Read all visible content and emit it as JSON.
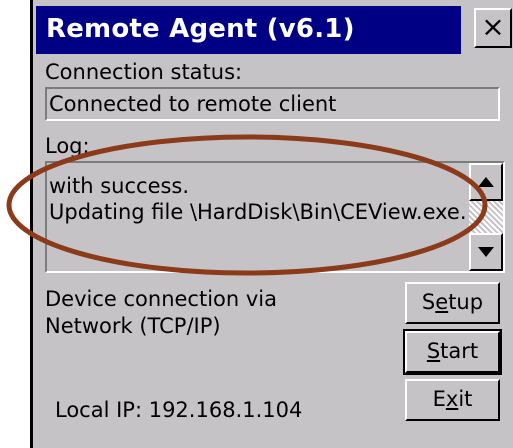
{
  "window": {
    "title": "Remote Agent (v6.1)",
    "close_glyph": "×"
  },
  "connection": {
    "label": "Connection status:",
    "value": "Connected to remote client"
  },
  "log": {
    "label": "Log:",
    "lines": [
      "with success.",
      "Updating file \\HardDisk\\Bin\\CEView.exe."
    ]
  },
  "device": {
    "line1": "Device connection via",
    "line2": "Network (TCP/IP)"
  },
  "local_ip": "Local IP: 192.168.1.104",
  "buttons": {
    "setup": {
      "pre": "S",
      "mn": "e",
      "post": "tup"
    },
    "start": {
      "pre": "",
      "mn": "S",
      "post": "tart"
    },
    "exit": {
      "pre": "E",
      "mn": "x",
      "post": "it"
    }
  },
  "colors": {
    "title_bar": "#000084",
    "face": "#c6c3c6",
    "annotation": "#8b3a1a"
  }
}
